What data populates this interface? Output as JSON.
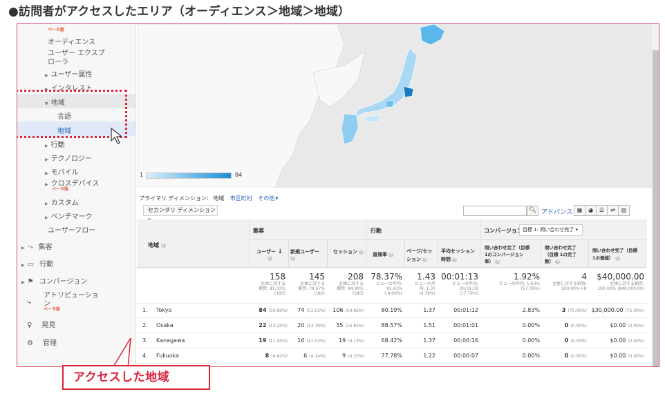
{
  "heading": "●訪問者がアクセスしたエリア（オーディエンス＞地域＞地域）",
  "callout": "アクセスした地域",
  "colors": {
    "accent": "#d9243c",
    "link": "#2a63c6",
    "beta": "#e3573a",
    "map_high": "#1b8fd6",
    "map_low": "#dceef9"
  },
  "sidebar": {
    "beta_top": "ベータ版",
    "audience": "オーディエンス",
    "user_explorer_1": "ユーザー エクスプ",
    "user_explorer_2": "ローラ",
    "user_attr": "ユーザー属性",
    "interests": "インタレスト",
    "geo": "地域",
    "language": "言語",
    "location": "地域",
    "behavior_sub": "行動",
    "technology": "テクノロジー",
    "mobile": "モバイル",
    "cross_device": "クロスデバイス",
    "cross_device_beta": "ベータ版",
    "custom": "カスタム",
    "benchmark": "ベンチマーク",
    "user_flow": "ユーザーフロー",
    "acquisition": "集客",
    "behavior": "行動",
    "conversion": "コンバージョン",
    "attribution_1": "アトリビューショ",
    "attribution_2": "ン",
    "attribution_beta": "ベータ版",
    "discover": "発見",
    "admin": "管理"
  },
  "map": {
    "legend_min": "1",
    "legend_max": "84"
  },
  "dimension": {
    "primary_label": "プライマリ ディメンション:",
    "primary_value": "地域",
    "city": "市区町村",
    "other": "その他",
    "secondary": "セカンダリ ディメンション",
    "advanced": "アドバンス"
  },
  "table": {
    "h_region": "地域",
    "h_acquisition": "集客",
    "h_behavior": "行動",
    "h_conversion": "コンバージョン",
    "goal_select": "目標 1: 問い合わせ完了",
    "h_users": "ユーザー",
    "h_new_users": "新規ユーザー",
    "h_sessions": "セッション",
    "h_bounce": "直帰率",
    "h_pps_1": "ページ/セッ",
    "h_pps_2": "ション",
    "h_dur_1": "平均セッション",
    "h_dur_2": "時間",
    "h_cr_1": "問い合わせ完了（目標",
    "h_cr_2": "1のコンバージョン",
    "h_cr_3": "率）",
    "h_comp_1": "問い合わせ完了",
    "h_comp_2": "（目標 1の完了",
    "h_comp_3": "数）",
    "h_val_1": "問い合わせ完了（目標",
    "h_val_2": "1の価値）",
    "totals": {
      "users": "158",
      "users_s1": "全体に対する",
      "users_s2": "割合: 81.03%",
      "users_s3": "(195)",
      "new_users": "145",
      "new_s1": "全体に対する",
      "new_s2": "割合: 79.67%",
      "new_s3": "(182)",
      "sessions": "208",
      "ses_s1": "全体に対する",
      "ses_s2": "割合: 84.90%",
      "ses_s3": "(245)",
      "bounce": "78.37%",
      "b_s1": "ビューの平均:",
      "b_s2": "81.63%",
      "b_s3": "(-4.00%)",
      "pps": "1.43",
      "p_s1": "ビューの平",
      "p_s2": "均: 1.37",
      "p_s3": "(4.78%)",
      "dur": "00:01:13",
      "d_s1": "ビューの平均:",
      "d_s2": "00:01:02",
      "d_s3": "(17.79%)",
      "cr": "1.92%",
      "cr_s1": "ビューの平均: 1.63%",
      "cr_s2": "(17.79%)",
      "comp": "4",
      "comp_s1": "全体に対する割合:",
      "comp_s2": "100.00% (4)",
      "val": "$40,000.00",
      "val_s1": "全体に対する割合:",
      "val_s2": "100.00% ($40,000.00)"
    },
    "rows": [
      {
        "idx": "1.",
        "name": "Tokyo",
        "users": "84",
        "users_pct": "(50.60%)",
        "new": "74",
        "new_pct": "(51.03%)",
        "ses": "106",
        "ses_pct": "(50.96%)",
        "bounce": "80.19%",
        "pps": "1.37",
        "dur": "00:01:12",
        "cr": "2.83%",
        "comp": "3",
        "comp_pct": "(75.00%)",
        "val": "$30,000.00",
        "val_pct": "(75.00%)"
      },
      {
        "idx": "2.",
        "name": "Osaka",
        "users": "22",
        "users_pct": "(13.25%)",
        "new": "20",
        "new_pct": "(13.79%)",
        "ses": "35",
        "ses_pct": "(16.83%)",
        "bounce": "88.57%",
        "pps": "1.51",
        "dur": "00:01:01",
        "cr": "0.00%",
        "comp": "0",
        "comp_pct": "(0.00%)",
        "val": "$0.00",
        "val_pct": "(0.00%)"
      },
      {
        "idx": "3.",
        "name": "Kanagawa",
        "users": "19",
        "users_pct": "(11.45%)",
        "new": "16",
        "new_pct": "(11.03%)",
        "ses": "19",
        "ses_pct": "(9.13%)",
        "bounce": "68.42%",
        "pps": "1.37",
        "dur": "00:00:16",
        "cr": "0.00%",
        "comp": "0",
        "comp_pct": "(0.00%)",
        "val": "$0.00",
        "val_pct": "(0.00%)"
      },
      {
        "idx": "4.",
        "name": "Fukuoka",
        "users": "8",
        "users_pct": "(4.82%)",
        "new": "6",
        "new_pct": "(4.14%)",
        "ses": "9",
        "ses_pct": "(4.33%)",
        "bounce": "77.78%",
        "pps": "1.22",
        "dur": "00:00:07",
        "cr": "0.00%",
        "comp": "0",
        "comp_pct": "(0.00%)",
        "val": "$0.00",
        "val_pct": "(0.00%)"
      }
    ]
  }
}
